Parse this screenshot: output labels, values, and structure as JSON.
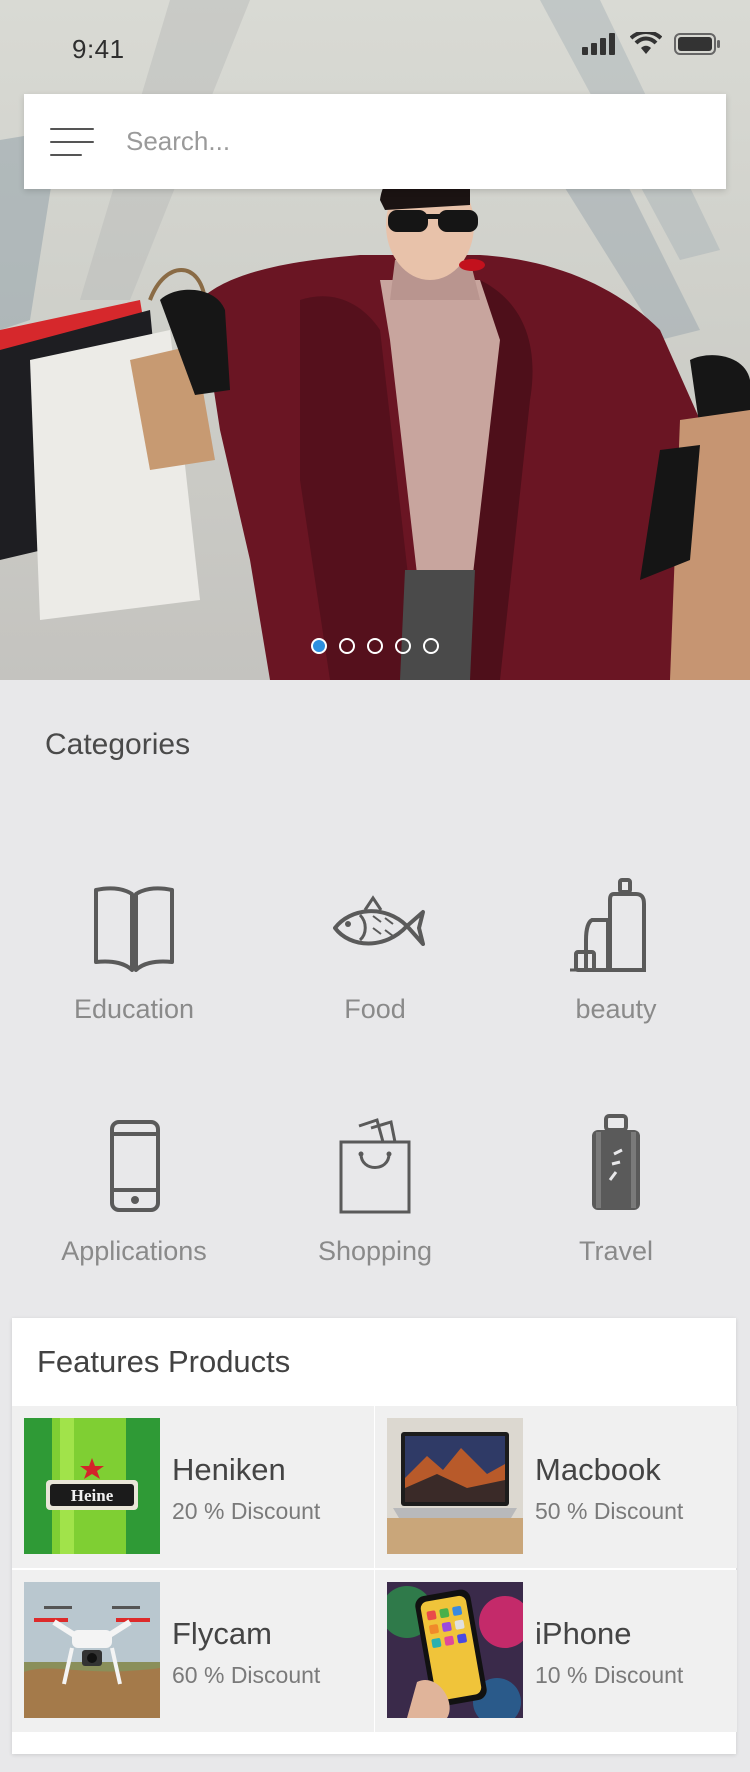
{
  "status_bar": {
    "time": "9:41",
    "icons": [
      "signal-icon",
      "wifi-icon",
      "battery-icon"
    ]
  },
  "search": {
    "placeholder": "Search...",
    "value": ""
  },
  "carousel": {
    "total": 5,
    "active_index": 0,
    "accent_color": "#2d8fe0"
  },
  "categories": {
    "title": "Categories",
    "items": [
      {
        "label": "Education",
        "icon": "book-icon"
      },
      {
        "label": "Food",
        "icon": "fish-icon"
      },
      {
        "label": "beauty",
        "icon": "cosmetics-icon"
      },
      {
        "label": "Applications",
        "icon": "phone-icon"
      },
      {
        "label": "Shopping",
        "icon": "shopping-bag-icon"
      },
      {
        "label": "Travel",
        "icon": "luggage-icon"
      }
    ]
  },
  "features": {
    "title": "Features Products",
    "products": [
      {
        "name": "Heniken",
        "discount": "20 % Discount"
      },
      {
        "name": "Macbook",
        "discount": "50 % Discount"
      },
      {
        "name": "Flycam",
        "discount": "60 % Discount"
      },
      {
        "name": "iPhone",
        "discount": "10 % Discount"
      }
    ]
  },
  "colors": {
    "background": "#e8e8ea",
    "card": "#ffffff",
    "cell": "#f0f0f0",
    "icon": "#5a5a5a"
  }
}
